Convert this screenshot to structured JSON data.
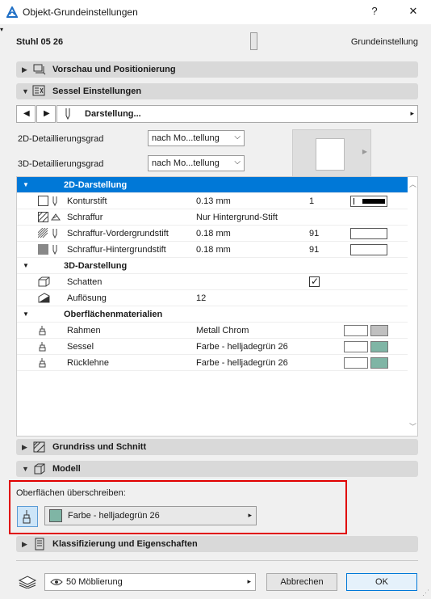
{
  "window": {
    "title": "Objekt-Grundeinstellungen",
    "help_label": "?",
    "close_label": "✕"
  },
  "header": {
    "object_name": "Stuhl 05 26",
    "mode_label": "Grundeinstellung"
  },
  "sections": {
    "preview": "Vorschau und Positionierung",
    "chair": "Sessel Einstellungen",
    "floorplan": "Grundriss und Schnitt",
    "model": "Modell",
    "classification": "Klassifizierung und Eigenschaften"
  },
  "page_nav": {
    "prev": "◀",
    "next": "▶",
    "current": "Darstellung...",
    "arrow": "▸"
  },
  "detail": {
    "label_2d": "2D-Detaillierungsgrad",
    "value_2d": "nach Mo...tellung",
    "label_3d": "3D-Detaillierungsgrad",
    "value_3d": "nach Mo...tellung"
  },
  "param_tree": {
    "group_2d": "2D-Darstellung",
    "contour_pen": {
      "name": "Konturstift",
      "value": "0.13 mm",
      "number": "1"
    },
    "hatch": {
      "name": "Schraffur",
      "value": "Nur Hintergrund-Stift"
    },
    "hatch_fg": {
      "name": "Schraffur-Vordergrundstift",
      "value": "0.18 mm",
      "number": "91"
    },
    "hatch_bg": {
      "name": "Schraffur-Hintergrundstift",
      "value": "0.18 mm",
      "number": "91"
    },
    "group_3d": "3D-Darstellung",
    "shadow": {
      "name": "Schatten",
      "checked": true,
      "check_glyph": "✓"
    },
    "resolution": {
      "name": "Auflösung",
      "value": "12"
    },
    "group_materials": "Oberflächenmaterialien",
    "frame": {
      "name": "Rahmen",
      "value": "Metall Chrom",
      "color": "#c0c0c0"
    },
    "seat": {
      "name": "Sessel",
      "value": "Farbe - helljadegrün 26",
      "color": "#7fb5a5"
    },
    "backrest": {
      "name": "Rücklehne",
      "value": "Farbe - helljadegrün 26",
      "color": "#7fb5a5"
    }
  },
  "override": {
    "label": "Oberflächen überschreiben:",
    "value": "Farbe - helljadegrün 26",
    "color": "#7fb5a5",
    "arrow": "▸"
  },
  "footer": {
    "favorites_value": "50 Möblierung",
    "cancel_label": "Abbrechen",
    "ok_label": "OK"
  },
  "colors": {
    "selection": "#0078d7",
    "override_border": "#e00000"
  }
}
